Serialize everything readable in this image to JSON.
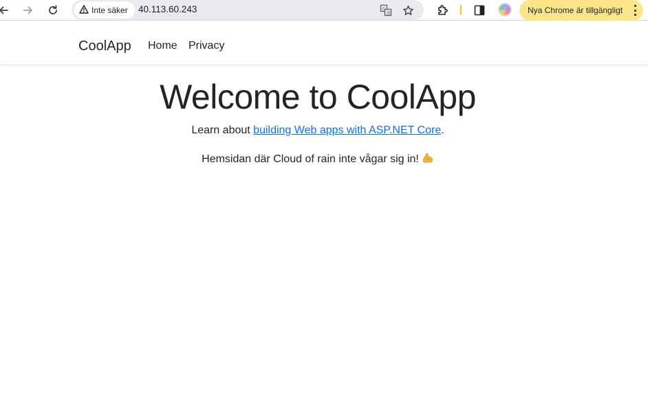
{
  "browser": {
    "security_label": "Inte säker",
    "url": "40.113.60.243",
    "update_label": "Nya Chrome är tillgängligt",
    "icons": [
      "back-icon",
      "forward-icon",
      "reload-icon",
      "warning-icon",
      "translate-icon",
      "star-icon",
      "extensions-icon",
      "side-panel-icon",
      "profile-avatar",
      "more-vert-icon"
    ],
    "colors": {
      "update_pill": "#fde68a",
      "omnibox": "#e9ebee",
      "divider": "#f5c518"
    }
  },
  "navbar": {
    "brand": "CoolApp",
    "links": [
      {
        "label": "Home"
      },
      {
        "label": "Privacy"
      }
    ]
  },
  "main": {
    "title": "Welcome to CoolApp",
    "learn_prefix": "Learn about ",
    "learn_link": "building Web apps with ASP.NET Core",
    "learn_suffix": ".",
    "tagline": "Hemsidan där Cloud of rain inte vågar sig in!",
    "tagline_emoji": "muscle-icon",
    "link_color": "#0d6efd"
  }
}
